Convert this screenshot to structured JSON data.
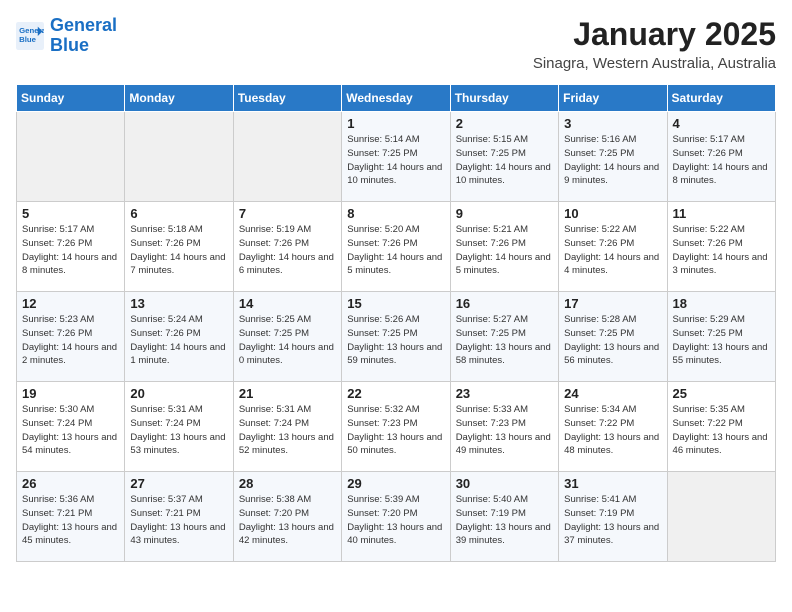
{
  "header": {
    "logo_line1": "General",
    "logo_line2": "Blue",
    "month": "January 2025",
    "location": "Sinagra, Western Australia, Australia"
  },
  "weekdays": [
    "Sunday",
    "Monday",
    "Tuesday",
    "Wednesday",
    "Thursday",
    "Friday",
    "Saturday"
  ],
  "weeks": [
    [
      {
        "day": "",
        "sunrise": "",
        "sunset": "",
        "daylight": ""
      },
      {
        "day": "",
        "sunrise": "",
        "sunset": "",
        "daylight": ""
      },
      {
        "day": "",
        "sunrise": "",
        "sunset": "",
        "daylight": ""
      },
      {
        "day": "1",
        "sunrise": "Sunrise: 5:14 AM",
        "sunset": "Sunset: 7:25 PM",
        "daylight": "Daylight: 14 hours and 10 minutes."
      },
      {
        "day": "2",
        "sunrise": "Sunrise: 5:15 AM",
        "sunset": "Sunset: 7:25 PM",
        "daylight": "Daylight: 14 hours and 10 minutes."
      },
      {
        "day": "3",
        "sunrise": "Sunrise: 5:16 AM",
        "sunset": "Sunset: 7:25 PM",
        "daylight": "Daylight: 14 hours and 9 minutes."
      },
      {
        "day": "4",
        "sunrise": "Sunrise: 5:17 AM",
        "sunset": "Sunset: 7:26 PM",
        "daylight": "Daylight: 14 hours and 8 minutes."
      }
    ],
    [
      {
        "day": "5",
        "sunrise": "Sunrise: 5:17 AM",
        "sunset": "Sunset: 7:26 PM",
        "daylight": "Daylight: 14 hours and 8 minutes."
      },
      {
        "day": "6",
        "sunrise": "Sunrise: 5:18 AM",
        "sunset": "Sunset: 7:26 PM",
        "daylight": "Daylight: 14 hours and 7 minutes."
      },
      {
        "day": "7",
        "sunrise": "Sunrise: 5:19 AM",
        "sunset": "Sunset: 7:26 PM",
        "daylight": "Daylight: 14 hours and 6 minutes."
      },
      {
        "day": "8",
        "sunrise": "Sunrise: 5:20 AM",
        "sunset": "Sunset: 7:26 PM",
        "daylight": "Daylight: 14 hours and 5 minutes."
      },
      {
        "day": "9",
        "sunrise": "Sunrise: 5:21 AM",
        "sunset": "Sunset: 7:26 PM",
        "daylight": "Daylight: 14 hours and 5 minutes."
      },
      {
        "day": "10",
        "sunrise": "Sunrise: 5:22 AM",
        "sunset": "Sunset: 7:26 PM",
        "daylight": "Daylight: 14 hours and 4 minutes."
      },
      {
        "day": "11",
        "sunrise": "Sunrise: 5:22 AM",
        "sunset": "Sunset: 7:26 PM",
        "daylight": "Daylight: 14 hours and 3 minutes."
      }
    ],
    [
      {
        "day": "12",
        "sunrise": "Sunrise: 5:23 AM",
        "sunset": "Sunset: 7:26 PM",
        "daylight": "Daylight: 14 hours and 2 minutes."
      },
      {
        "day": "13",
        "sunrise": "Sunrise: 5:24 AM",
        "sunset": "Sunset: 7:26 PM",
        "daylight": "Daylight: 14 hours and 1 minute."
      },
      {
        "day": "14",
        "sunrise": "Sunrise: 5:25 AM",
        "sunset": "Sunset: 7:25 PM",
        "daylight": "Daylight: 14 hours and 0 minutes."
      },
      {
        "day": "15",
        "sunrise": "Sunrise: 5:26 AM",
        "sunset": "Sunset: 7:25 PM",
        "daylight": "Daylight: 13 hours and 59 minutes."
      },
      {
        "day": "16",
        "sunrise": "Sunrise: 5:27 AM",
        "sunset": "Sunset: 7:25 PM",
        "daylight": "Daylight: 13 hours and 58 minutes."
      },
      {
        "day": "17",
        "sunrise": "Sunrise: 5:28 AM",
        "sunset": "Sunset: 7:25 PM",
        "daylight": "Daylight: 13 hours and 56 minutes."
      },
      {
        "day": "18",
        "sunrise": "Sunrise: 5:29 AM",
        "sunset": "Sunset: 7:25 PM",
        "daylight": "Daylight: 13 hours and 55 minutes."
      }
    ],
    [
      {
        "day": "19",
        "sunrise": "Sunrise: 5:30 AM",
        "sunset": "Sunset: 7:24 PM",
        "daylight": "Daylight: 13 hours and 54 minutes."
      },
      {
        "day": "20",
        "sunrise": "Sunrise: 5:31 AM",
        "sunset": "Sunset: 7:24 PM",
        "daylight": "Daylight: 13 hours and 53 minutes."
      },
      {
        "day": "21",
        "sunrise": "Sunrise: 5:31 AM",
        "sunset": "Sunset: 7:24 PM",
        "daylight": "Daylight: 13 hours and 52 minutes."
      },
      {
        "day": "22",
        "sunrise": "Sunrise: 5:32 AM",
        "sunset": "Sunset: 7:23 PM",
        "daylight": "Daylight: 13 hours and 50 minutes."
      },
      {
        "day": "23",
        "sunrise": "Sunrise: 5:33 AM",
        "sunset": "Sunset: 7:23 PM",
        "daylight": "Daylight: 13 hours and 49 minutes."
      },
      {
        "day": "24",
        "sunrise": "Sunrise: 5:34 AM",
        "sunset": "Sunset: 7:22 PM",
        "daylight": "Daylight: 13 hours and 48 minutes."
      },
      {
        "day": "25",
        "sunrise": "Sunrise: 5:35 AM",
        "sunset": "Sunset: 7:22 PM",
        "daylight": "Daylight: 13 hours and 46 minutes."
      }
    ],
    [
      {
        "day": "26",
        "sunrise": "Sunrise: 5:36 AM",
        "sunset": "Sunset: 7:21 PM",
        "daylight": "Daylight: 13 hours and 45 minutes."
      },
      {
        "day": "27",
        "sunrise": "Sunrise: 5:37 AM",
        "sunset": "Sunset: 7:21 PM",
        "daylight": "Daylight: 13 hours and 43 minutes."
      },
      {
        "day": "28",
        "sunrise": "Sunrise: 5:38 AM",
        "sunset": "Sunset: 7:20 PM",
        "daylight": "Daylight: 13 hours and 42 minutes."
      },
      {
        "day": "29",
        "sunrise": "Sunrise: 5:39 AM",
        "sunset": "Sunset: 7:20 PM",
        "daylight": "Daylight: 13 hours and 40 minutes."
      },
      {
        "day": "30",
        "sunrise": "Sunrise: 5:40 AM",
        "sunset": "Sunset: 7:19 PM",
        "daylight": "Daylight: 13 hours and 39 minutes."
      },
      {
        "day": "31",
        "sunrise": "Sunrise: 5:41 AM",
        "sunset": "Sunset: 7:19 PM",
        "daylight": "Daylight: 13 hours and 37 minutes."
      },
      {
        "day": "",
        "sunrise": "",
        "sunset": "",
        "daylight": ""
      }
    ]
  ]
}
